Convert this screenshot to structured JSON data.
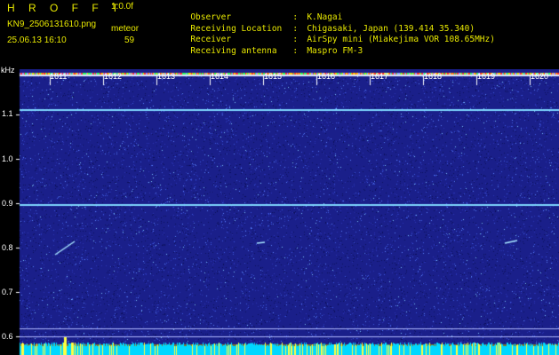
{
  "header": {
    "brand": "H R O F F T",
    "version": "1.0.0f",
    "filename": "KN9_2506131610.png",
    "datetime": "25.06.13 16:10",
    "meteor_label": "meteor",
    "meteor_count": "59",
    "info": [
      {
        "key": "Observer",
        "sep": ":",
        "value": "K.Nagai"
      },
      {
        "key": "Receiving Location",
        "sep": ":",
        "value": "Chigasaki, Japan (139.414 35.340)"
      },
      {
        "key": "Receiver",
        "sep": ":",
        "value": "AirSpy mini (Miakejima VOR 108.65MHz)"
      },
      {
        "key": "Receiving antenna",
        "sep": ":",
        "value": "Maspro FM-3"
      }
    ]
  },
  "axis": {
    "unit": "kHz",
    "y_ticks": [
      "1.1",
      "1.0",
      "0.9",
      "0.8",
      "0.7",
      "0.6"
    ],
    "minute_labels": [
      "1611",
      "1612",
      "1613",
      "1614",
      "1615",
      "1616",
      "1617",
      "1618",
      "1619",
      "1620"
    ]
  },
  "colors": {
    "background": "#1a1f8a",
    "text": "#e8e800",
    "carrier": "#7fd7ff",
    "baseline": "#00d8ff"
  }
}
